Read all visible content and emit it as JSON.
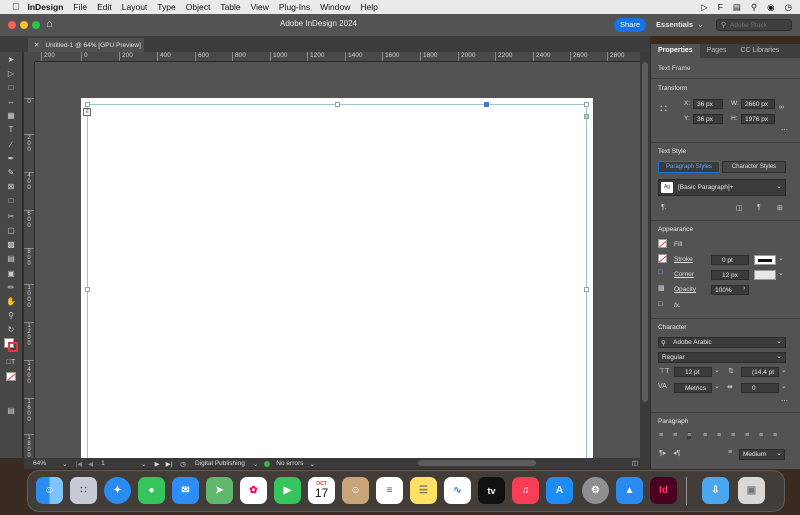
{
  "menubar": {
    "app_name": "InDesign",
    "items": [
      "File",
      "Edit",
      "Layout",
      "Type",
      "Object",
      "Table",
      "View",
      "Plug-Ins",
      "Window",
      "Help"
    ]
  },
  "titlebar": {
    "title": "Adobe InDesign 2024",
    "share_label": "Share",
    "workspace": "Essentials",
    "stock_placeholder": "Adobe Stock"
  },
  "document_tab": {
    "label": "Untitled-1 @ 64% [GPU Preview]"
  },
  "rulers": {
    "horizontal": [
      "200",
      "0",
      "200",
      "400",
      "600",
      "800",
      "1000",
      "1200",
      "1400",
      "1600",
      "1800",
      "2000",
      "2200",
      "2400",
      "2600",
      "2800"
    ],
    "vertical": [
      "0",
      "2\n0\n0",
      "4\n0\n0",
      "6\n0\n0",
      "8\n0\n0",
      "1\n0\n0\n0",
      "1\n2\n0\n0",
      "1\n4\n0\n0",
      "1\n6\n0\n0",
      "1\n8\n0\n0"
    ]
  },
  "statusbar": {
    "zoom": "64%",
    "page": "1",
    "preflight_profile": "Digital Publishing",
    "errors": "No errors"
  },
  "panel": {
    "tabs": [
      "Properties",
      "Pages",
      "CC Libraries"
    ],
    "object_type": "Text Frame",
    "transform": {
      "title": "Transform",
      "x_label": "X:",
      "x": "36 px",
      "y_label": "Y:",
      "y": "36 px",
      "w_label": "W:",
      "w": "2660 px",
      "h_label": "H:",
      "h": "1976 px"
    },
    "text_style": {
      "title": "Text Style",
      "tab_paragraph": "Paragraph Styles",
      "tab_character": "Character Styles",
      "style": "[Basic Paragraph]+"
    },
    "appearance": {
      "title": "Appearance",
      "fill": "Fill",
      "stroke": "Stroke",
      "stroke_value": "0 pt",
      "corner": "Corner",
      "corner_value": "12 px",
      "opacity": "Opacity",
      "opacity_value": "100%",
      "fx": "fx."
    },
    "character": {
      "title": "Character",
      "font": "Adobe Arabic",
      "style": "Regular",
      "size": "12 pt",
      "leading": "(14,4 pt",
      "kerning": "Metrics",
      "tracking": "0"
    },
    "paragraph": {
      "title": "Paragraph",
      "weight": "Medium"
    }
  },
  "dock": {
    "calendar_month": "OCT",
    "calendar_day": "17",
    "tv_label": "tv",
    "indesign_label": "Id"
  },
  "colors": {
    "accent": "#1473e6",
    "ui_dark": "#535353",
    "page": "#ffffff",
    "margin_guide": "#9cc4d6"
  }
}
